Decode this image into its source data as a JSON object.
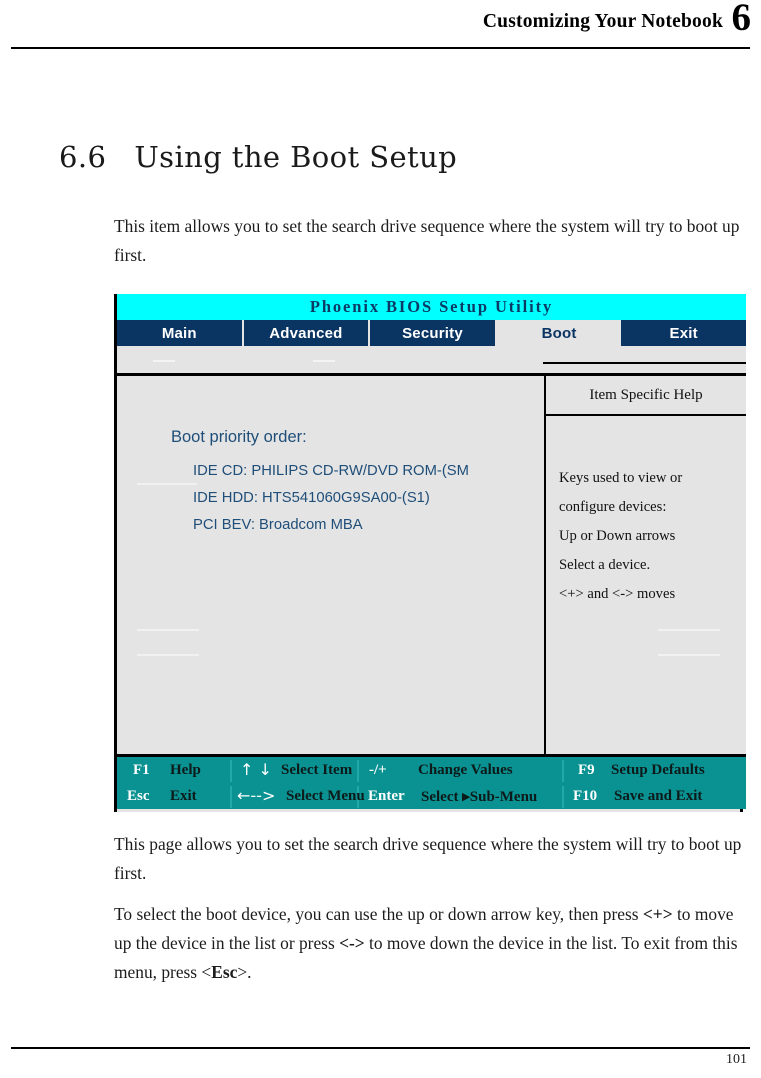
{
  "header": {
    "running_title": "Customizing Your Notebook",
    "chapter_number": "6"
  },
  "section": {
    "number": "6.6",
    "title": "Using the Boot Setup"
  },
  "paragraphs": {
    "intro": "This item allows you to set the search drive sequence where the system will try to boot up first.",
    "after_1": "This page allows you to set the search drive sequence where the system will try to boot up first.",
    "after_2_part1": "To select the boot device, you can use the up or down arrow key, then press ",
    "after_2_key_plus": "<+>",
    "after_2_part2": " to move up the device in the list or press ",
    "after_2_key_minus": "<->",
    "after_2_part3": " to move down the device in the list. To exit from this menu, press <",
    "after_2_key_esc": "Esc",
    "after_2_part4": ">."
  },
  "bios": {
    "title": "Phoenix BIOS Setup Utility",
    "title_bg": "#00ffff",
    "title_fg": "#0b3a64",
    "tab_bg": "#0a3563",
    "tab_fg": "#ffffff",
    "active_tab_bg": "#e4e4e4",
    "active_tab_fg": "#0a3563",
    "body_bg": "#e4e4e4",
    "list_fg": "#1f4e79",
    "fkeybar_bg": "#0a9191",
    "tabs": [
      {
        "label": "Main",
        "active": false
      },
      {
        "label": "Advanced",
        "active": false
      },
      {
        "label": "Security",
        "active": false
      },
      {
        "label": "Boot",
        "active": true
      },
      {
        "label": "Exit",
        "active": false
      }
    ],
    "boot_order_title": "Boot priority order:",
    "boot_items": [
      "IDE CD:  PHILIPS CD-RW/DVD ROM-(SM",
      "IDE HDD: HTS541060G9SA00-(S1)",
      "PCI BEV: Broadcom MBA"
    ],
    "help": {
      "title": "Item Specific Help",
      "lines": [
        "Keys used to view or",
        "configure devices:",
        "Up or Down arrows",
        "Select a device.",
        "<+> and <-> moves"
      ]
    },
    "fkeys": {
      "row1": [
        {
          "key": "F1",
          "label": "Help"
        },
        {
          "key": "↑ ↓",
          "label": "Select Item"
        },
        {
          "key": "-/+",
          "label": "Change Values"
        },
        {
          "key": "F9",
          "label": "Setup Defaults"
        }
      ],
      "row2": [
        {
          "key": "Esc",
          "label": "Exit"
        },
        {
          "key": "←-->",
          "label": "Select Menu"
        },
        {
          "key": "Enter",
          "label": "Select ▸Sub-Menu"
        },
        {
          "key": "F10",
          "label": "Save and Exit"
        }
      ]
    }
  },
  "footer": {
    "page_number": "101"
  }
}
